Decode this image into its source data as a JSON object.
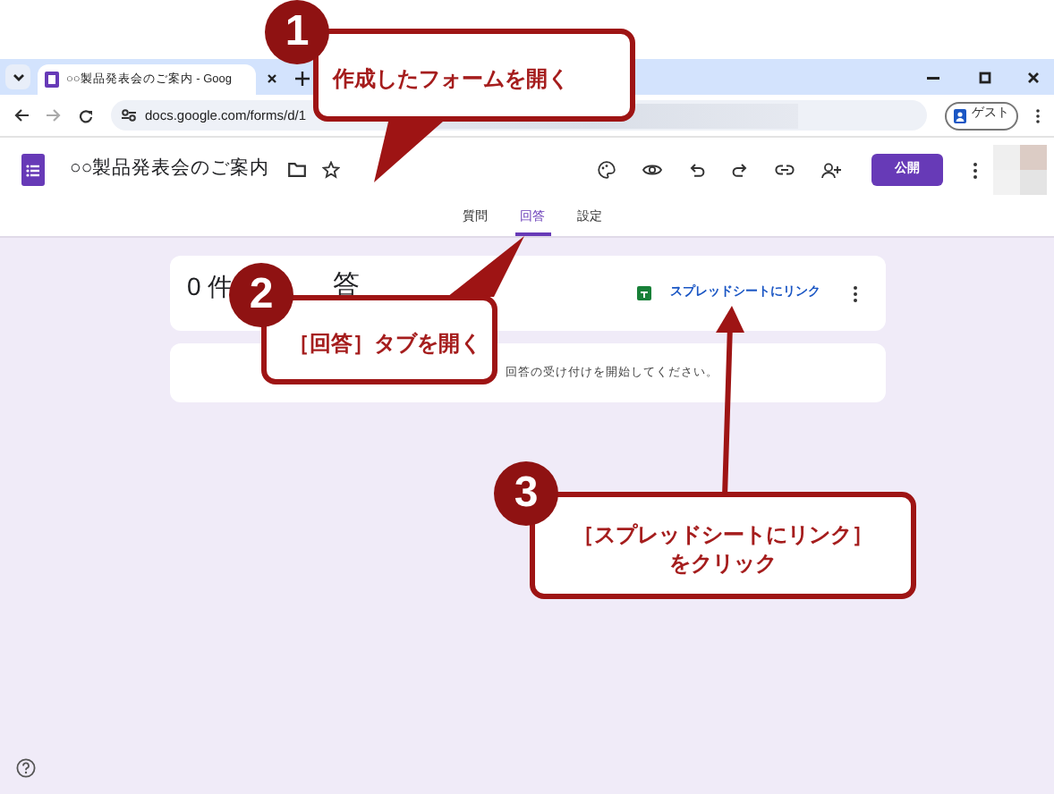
{
  "browser": {
    "tab_title": "○○製品発表会のご案内 - Goog",
    "url": "docs.google.com/forms/d/1",
    "profile_label": "ゲスト"
  },
  "form_header": {
    "title": "○○製品発表会のご案内",
    "publish_button": "公開"
  },
  "tabs": [
    {
      "label": "質問",
      "selected": false
    },
    {
      "label": "回答",
      "selected": true
    },
    {
      "label": "設定",
      "selected": false
    }
  ],
  "responses_card": {
    "count": "0 件",
    "heading": "答",
    "link": "スプレッドシートにリンク"
  },
  "notice": "回答の受け付けを開始してください。",
  "callouts": [
    {
      "number": "1",
      "lines": [
        "作成したフォームを開く"
      ]
    },
    {
      "number": "2",
      "lines": [
        "［回答］タブを開く"
      ]
    },
    {
      "number": "3",
      "lines": [
        "［スプレッドシートにリンク］",
        "をクリック"
      ]
    }
  ]
}
